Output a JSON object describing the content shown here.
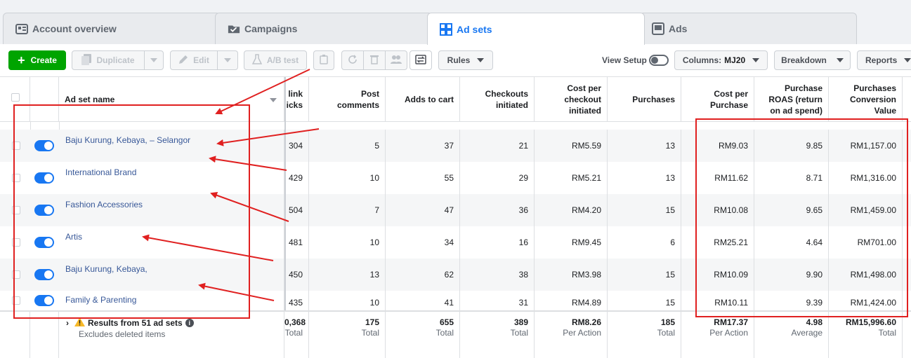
{
  "tabs": [
    {
      "label": "Account overview",
      "icon": "account-overview-icon"
    },
    {
      "label": "Campaigns",
      "icon": "folder-icon"
    },
    {
      "label": "Ad sets",
      "icon": "grid-icon"
    },
    {
      "label": "Ads",
      "icon": "monitor-icon"
    }
  ],
  "toolbar": {
    "create": "Create",
    "duplicate": "Duplicate",
    "edit": "Edit",
    "ab_test": "A/B test",
    "rules": "Rules",
    "view_setup": "View Setup",
    "columns_prefix": "Columns:",
    "columns_value": "MJ20",
    "breakdown": "Breakdown",
    "reports": "Reports"
  },
  "columns": {
    "name": "Ad set name",
    "link_clicks": "e link\nclicks",
    "post_comments": "Post\ncomments",
    "adds_to_cart": "Adds to cart",
    "checkouts": "Checkouts\ninitiated",
    "cost_per_checkout": "Cost per\ncheckout\ninitiated",
    "purchases": "Purchases",
    "cost_per_purchase": "Cost per\nPurchase",
    "roas": "Purchase\nROAS (return\non ad spend)",
    "conversion_value": "Purchases\nConversion\nValue"
  },
  "rows": [
    {
      "name": "Baju Kurung, Kebaya, – Selangor",
      "link_clicks": "304",
      "post_comments": "5",
      "adds_to_cart": "37",
      "checkouts": "21",
      "cost_per_checkout": "RM5.59",
      "purchases": "13",
      "cost_per_purchase": "RM9.03",
      "roas": "9.85",
      "conversion_value": "RM1,157.00"
    },
    {
      "name": "International Brand",
      "link_clicks": "429",
      "post_comments": "10",
      "adds_to_cart": "55",
      "checkouts": "29",
      "cost_per_checkout": "RM5.21",
      "purchases": "13",
      "cost_per_purchase": "RM11.62",
      "roas": "8.71",
      "conversion_value": "RM1,316.00"
    },
    {
      "name": "Fashion Accessories",
      "link_clicks": "504",
      "post_comments": "7",
      "adds_to_cart": "47",
      "checkouts": "36",
      "cost_per_checkout": "RM4.20",
      "purchases": "15",
      "cost_per_purchase": "RM10.08",
      "roas": "9.65",
      "conversion_value": "RM1,459.00"
    },
    {
      "name": "Artis",
      "link_clicks": "481",
      "post_comments": "10",
      "adds_to_cart": "34",
      "checkouts": "16",
      "cost_per_checkout": "RM9.45",
      "purchases": "6",
      "cost_per_purchase": "RM25.21",
      "roas": "4.64",
      "conversion_value": "RM701.00"
    },
    {
      "name": "Baju Kurung, Kebaya,",
      "link_clicks": "450",
      "post_comments": "13",
      "adds_to_cart": "62",
      "checkouts": "38",
      "cost_per_checkout": "RM3.98",
      "purchases": "15",
      "cost_per_purchase": "RM10.09",
      "roas": "9.90",
      "conversion_value": "RM1,498.00"
    },
    {
      "name": "Family & Parenting",
      "link_clicks": "435",
      "post_comments": "10",
      "adds_to_cart": "41",
      "checkouts": "31",
      "cost_per_checkout": "RM4.89",
      "purchases": "15",
      "cost_per_purchase": "RM10.11",
      "roas": "9.39",
      "conversion_value": "RM1,424.00"
    }
  ],
  "totals": {
    "label": "Results from 51 ad sets",
    "sublabel": "Excludes deleted items",
    "link_clicks": {
      "v": "0,368",
      "s": "Total"
    },
    "post_comments": {
      "v": "175",
      "s": "Total"
    },
    "adds_to_cart": {
      "v": "655",
      "s": "Total"
    },
    "checkouts": {
      "v": "389",
      "s": "Total"
    },
    "cost_per_checkout": {
      "v": "RM8.26",
      "s": "Per Action"
    },
    "purchases": {
      "v": "185",
      "s": "Total"
    },
    "cost_per_purchase": {
      "v": "RM17.37",
      "s": "Per Action"
    },
    "roas": {
      "v": "4.98",
      "s": "Average"
    },
    "conversion_value": {
      "v": "RM15,996.60",
      "s": "Total"
    }
  },
  "colors": {
    "accent": "#1877f2",
    "create": "#00a400",
    "annotation": "#e02020",
    "link": "#385898"
  }
}
